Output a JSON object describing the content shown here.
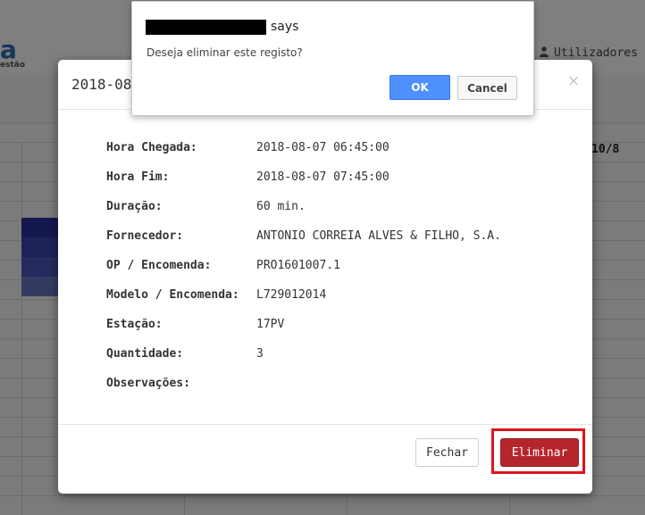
{
  "background": {
    "brand": "a",
    "brand_sub": "estão",
    "user_menu": "Utilizadores",
    "day_label": "10/8",
    "colors": {
      "block_dark": "#2a2f9f",
      "block_mid": "#3a45b0",
      "block_light": "#5a66c0"
    }
  },
  "modal": {
    "title": "2018-08",
    "close_icon": "×",
    "details": [
      {
        "label": "Hora Chegada:",
        "value": "2018-08-07 06:45:00"
      },
      {
        "label": "Hora Fim:",
        "value": "2018-08-07 07:45:00"
      },
      {
        "label": "Duração:",
        "value": "60 min."
      },
      {
        "label": "Fornecedor:",
        "value": "ANTONIO CORREIA ALVES & FILHO, S.A."
      },
      {
        "label": "OP / Encomenda:",
        "value": "PRO1601007.1"
      },
      {
        "label": "Modelo / Encomenda:",
        "value": "L729012014"
      },
      {
        "label": "Estação:",
        "value": "17PV"
      },
      {
        "label": "Quantidade:",
        "value": "3"
      },
      {
        "label": "Observações:",
        "value": ""
      }
    ],
    "buttons": {
      "close": "Fechar",
      "delete": "Eliminar"
    },
    "colors": {
      "delete": "#b5262c",
      "highlight": "#e0141b"
    }
  },
  "confirm": {
    "says": "says",
    "message": "Deseja eliminar este registo?",
    "ok": "OK",
    "cancel": "Cancel",
    "colors": {
      "ok": "#4d90fe"
    }
  }
}
